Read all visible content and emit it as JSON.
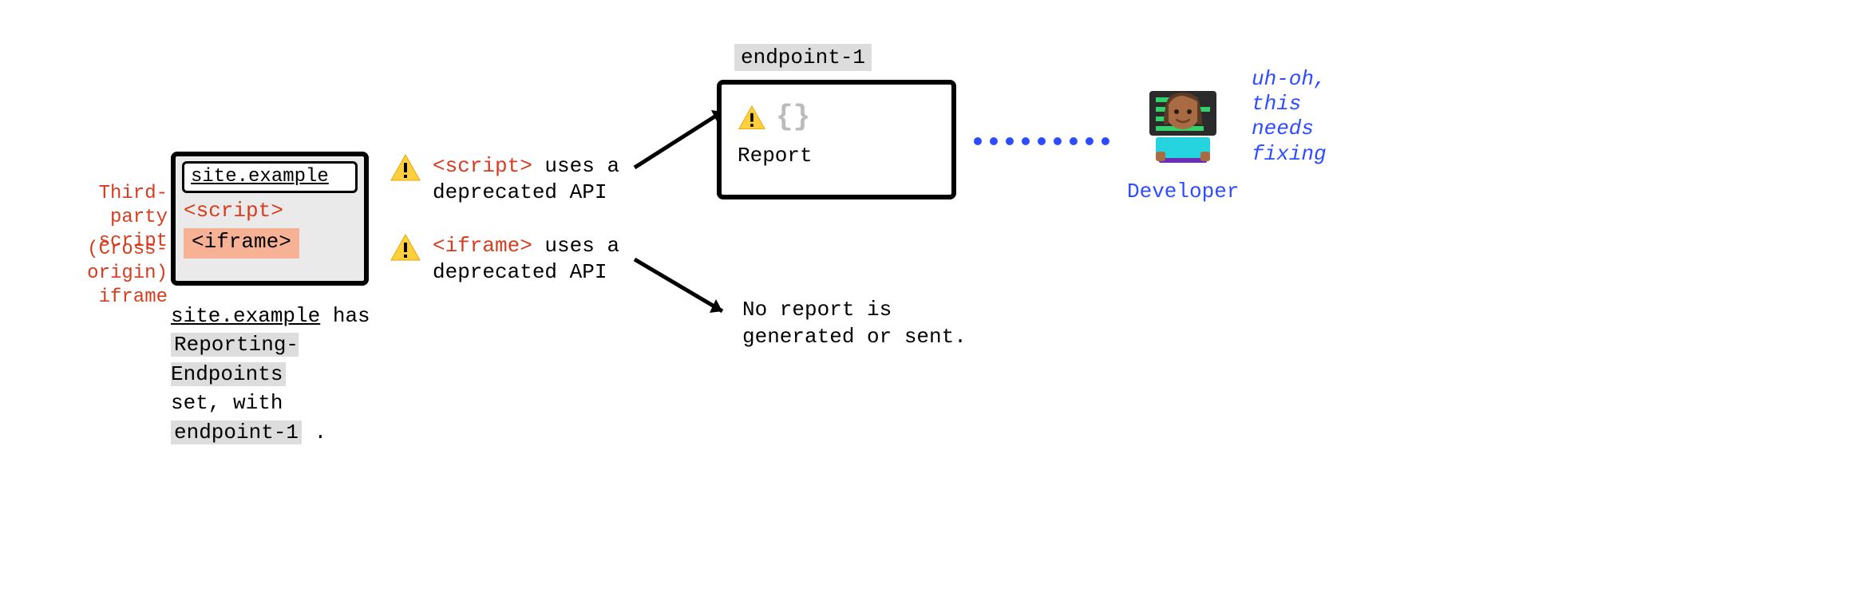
{
  "leftLabels": {
    "thirdParty1": "Third-party",
    "thirdParty2": "script",
    "crossOrigin1": "(Cross-origin)",
    "crossOrigin2": "iframe"
  },
  "browser": {
    "url": "site.example",
    "scriptTag": "<script>",
    "iframeTag": "<iframe>"
  },
  "caption": {
    "line1_ul": "site.example",
    "line1_rest": " has",
    "line2_hl": "Reporting-Endpoints",
    "line3_a": "set, with ",
    "line3_hl": "endpoint-1",
    "line3_b": " ."
  },
  "warnings": {
    "script_code": "<script>",
    "script_rest": " uses a",
    "script_line2": "deprecated API",
    "iframe_code": "<iframe>",
    "iframe_rest": " uses a",
    "iframe_line2": "deprecated API"
  },
  "endpoint": {
    "label": "endpoint-1",
    "braces": "{}",
    "report": "Report"
  },
  "noReport": {
    "line1": "No report is",
    "line2": "generated or sent."
  },
  "developer": {
    "label": "Developer",
    "quote1": "uh-oh,",
    "quote2": "this",
    "quote3": "needs",
    "quote4": "fixing"
  }
}
